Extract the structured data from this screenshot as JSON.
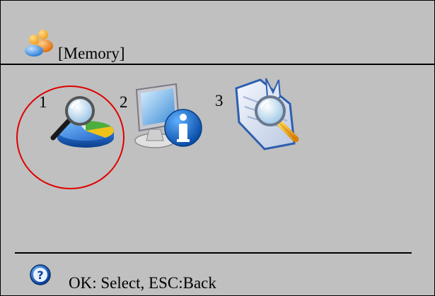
{
  "header": {
    "title": "[Memory]",
    "icon": "users-icon"
  },
  "items": [
    {
      "number": "1",
      "icon": "disk-usage-search-icon",
      "selected": true
    },
    {
      "number": "2",
      "icon": "system-info-icon",
      "selected": false
    },
    {
      "number": "3",
      "icon": "document-search-icon",
      "selected": false
    }
  ],
  "footer": {
    "icon": "help-icon",
    "hint": "OK: Select, ESC:Back"
  },
  "colors": {
    "background": "#c0c0c0",
    "selection": "#e00000"
  }
}
